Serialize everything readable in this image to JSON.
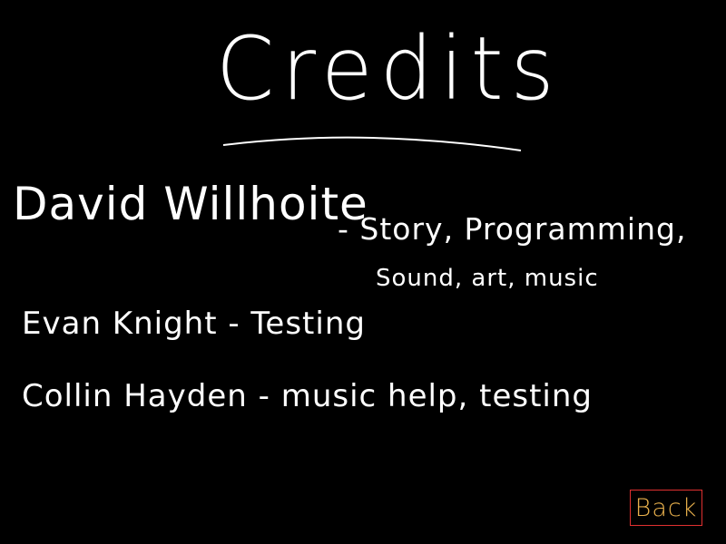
{
  "screen": {
    "title": "Credits",
    "credits": [
      {
        "line": "David Willhoite",
        "role_line1": "- Story, Programming,",
        "role_line2": "Sound, art, music"
      },
      {
        "line": "Evan Knight - Testing"
      },
      {
        "line": "Collin Hayden - music help, testing"
      }
    ],
    "back_label": "Back"
  },
  "colors": {
    "background": "#000000",
    "text": "#ffffff",
    "back_border": "#e03030",
    "back_text": "#e8b04c"
  }
}
